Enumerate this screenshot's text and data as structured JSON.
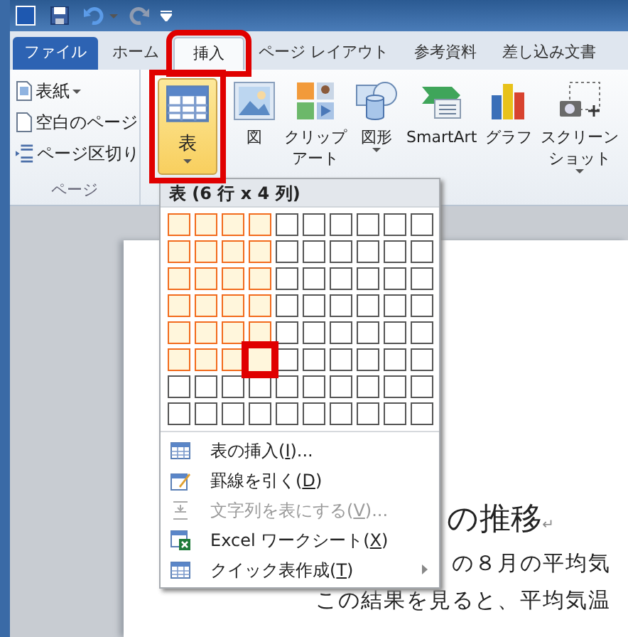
{
  "quick_access": {
    "undo_disabled": false,
    "redo_disabled": true
  },
  "tabs": [
    {
      "label": "ファイル",
      "kind": "file",
      "selected": false
    },
    {
      "label": "ホーム",
      "kind": "tab",
      "selected": false
    },
    {
      "label": "挿入",
      "kind": "tab",
      "selected": true,
      "framed": true
    },
    {
      "label": "ページ レイアウト",
      "kind": "tab",
      "selected": false
    },
    {
      "label": "参考資料",
      "kind": "tab",
      "selected": false
    },
    {
      "label": "差し込み文書",
      "kind": "tab",
      "selected": false
    }
  ],
  "page_group": {
    "items": [
      {
        "label": "表紙",
        "kind": "cover",
        "dropdown": true
      },
      {
        "label": "空白のページ",
        "kind": "blank",
        "dropdown": false
      },
      {
        "label": "ページ区切り",
        "kind": "break",
        "dropdown": false
      }
    ],
    "label": "ページ"
  },
  "table_button": {
    "label": "表",
    "open": true,
    "framed": true
  },
  "ribbon_buttons": [
    {
      "lines": [
        "図"
      ],
      "kind": "picture",
      "dropdown": false
    },
    {
      "lines": [
        "クリップ",
        "アート"
      ],
      "kind": "clipart",
      "dropdown": false
    },
    {
      "lines": [
        "図形"
      ],
      "kind": "shapes",
      "dropdown": true
    },
    {
      "lines": [
        "SmartArt"
      ],
      "kind": "smartart",
      "dropdown": false
    },
    {
      "lines": [
        "グラフ"
      ],
      "kind": "chart",
      "dropdown": false
    },
    {
      "lines": [
        "スクリーン",
        "ショット"
      ],
      "kind": "screenshot",
      "dropdown": true
    }
  ],
  "table_menu": {
    "title": "表 (6 行 x 4 列)",
    "grid": [
      {
        "cells": [
          {
            "highlighted": true,
            "pointed": false
          },
          {
            "highlighted": true,
            "pointed": false
          },
          {
            "highlighted": true,
            "pointed": false
          },
          {
            "highlighted": true,
            "pointed": false
          },
          {
            "highlighted": false,
            "pointed": false
          },
          {
            "highlighted": false,
            "pointed": false
          },
          {
            "highlighted": false,
            "pointed": false
          },
          {
            "highlighted": false,
            "pointed": false
          },
          {
            "highlighted": false,
            "pointed": false
          },
          {
            "highlighted": false,
            "pointed": false
          }
        ]
      },
      {
        "cells": [
          {
            "highlighted": true,
            "pointed": false
          },
          {
            "highlighted": true,
            "pointed": false
          },
          {
            "highlighted": true,
            "pointed": false
          },
          {
            "highlighted": true,
            "pointed": false
          },
          {
            "highlighted": false,
            "pointed": false
          },
          {
            "highlighted": false,
            "pointed": false
          },
          {
            "highlighted": false,
            "pointed": false
          },
          {
            "highlighted": false,
            "pointed": false
          },
          {
            "highlighted": false,
            "pointed": false
          },
          {
            "highlighted": false,
            "pointed": false
          }
        ]
      },
      {
        "cells": [
          {
            "highlighted": true,
            "pointed": false
          },
          {
            "highlighted": true,
            "pointed": false
          },
          {
            "highlighted": true,
            "pointed": false
          },
          {
            "highlighted": true,
            "pointed": false
          },
          {
            "highlighted": false,
            "pointed": false
          },
          {
            "highlighted": false,
            "pointed": false
          },
          {
            "highlighted": false,
            "pointed": false
          },
          {
            "highlighted": false,
            "pointed": false
          },
          {
            "highlighted": false,
            "pointed": false
          },
          {
            "highlighted": false,
            "pointed": false
          }
        ]
      },
      {
        "cells": [
          {
            "highlighted": true,
            "pointed": false
          },
          {
            "highlighted": true,
            "pointed": false
          },
          {
            "highlighted": true,
            "pointed": false
          },
          {
            "highlighted": true,
            "pointed": false
          },
          {
            "highlighted": false,
            "pointed": false
          },
          {
            "highlighted": false,
            "pointed": false
          },
          {
            "highlighted": false,
            "pointed": false
          },
          {
            "highlighted": false,
            "pointed": false
          },
          {
            "highlighted": false,
            "pointed": false
          },
          {
            "highlighted": false,
            "pointed": false
          }
        ]
      },
      {
        "cells": [
          {
            "highlighted": true,
            "pointed": false
          },
          {
            "highlighted": true,
            "pointed": false
          },
          {
            "highlighted": true,
            "pointed": false
          },
          {
            "highlighted": true,
            "pointed": false
          },
          {
            "highlighted": false,
            "pointed": false
          },
          {
            "highlighted": false,
            "pointed": false
          },
          {
            "highlighted": false,
            "pointed": false
          },
          {
            "highlighted": false,
            "pointed": false
          },
          {
            "highlighted": false,
            "pointed": false
          },
          {
            "highlighted": false,
            "pointed": false
          }
        ]
      },
      {
        "cells": [
          {
            "highlighted": true,
            "pointed": false
          },
          {
            "highlighted": true,
            "pointed": false
          },
          {
            "highlighted": true,
            "pointed": false
          },
          {
            "highlighted": true,
            "pointed": true
          },
          {
            "highlighted": false,
            "pointed": false
          },
          {
            "highlighted": false,
            "pointed": false
          },
          {
            "highlighted": false,
            "pointed": false
          },
          {
            "highlighted": false,
            "pointed": false
          },
          {
            "highlighted": false,
            "pointed": false
          },
          {
            "highlighted": false,
            "pointed": false
          }
        ]
      },
      {
        "cells": [
          {
            "highlighted": false,
            "pointed": false
          },
          {
            "highlighted": false,
            "pointed": false
          },
          {
            "highlighted": false,
            "pointed": false
          },
          {
            "highlighted": false,
            "pointed": false
          },
          {
            "highlighted": false,
            "pointed": false
          },
          {
            "highlighted": false,
            "pointed": false
          },
          {
            "highlighted": false,
            "pointed": false
          },
          {
            "highlighted": false,
            "pointed": false
          },
          {
            "highlighted": false,
            "pointed": false
          },
          {
            "highlighted": false,
            "pointed": false
          }
        ]
      },
      {
        "cells": [
          {
            "highlighted": false,
            "pointed": false
          },
          {
            "highlighted": false,
            "pointed": false
          },
          {
            "highlighted": false,
            "pointed": false
          },
          {
            "highlighted": false,
            "pointed": false
          },
          {
            "highlighted": false,
            "pointed": false
          },
          {
            "highlighted": false,
            "pointed": false
          },
          {
            "highlighted": false,
            "pointed": false
          },
          {
            "highlighted": false,
            "pointed": false
          },
          {
            "highlighted": false,
            "pointed": false
          },
          {
            "highlighted": false,
            "pointed": false
          }
        ]
      }
    ],
    "items": [
      {
        "before": "表の挿入(",
        "key": "I",
        "after": ")...",
        "kind": "insert",
        "disabled": false,
        "submenu": false
      },
      {
        "before": "罫線を引く(",
        "key": "D",
        "after": ")",
        "kind": "draw",
        "disabled": false,
        "submenu": false
      },
      {
        "before": "文字列を表にする(",
        "key": "V",
        "after": ")...",
        "kind": "convert",
        "disabled": true,
        "submenu": false
      },
      {
        "before": "Excel ワークシート(",
        "key": "X",
        "after": ")",
        "kind": "excel",
        "disabled": false,
        "submenu": false
      },
      {
        "before": "クイック表作成(",
        "key": "T",
        "after": ")",
        "kind": "quick",
        "disabled": false,
        "submenu": true
      }
    ]
  },
  "document": {
    "heading": "の推移",
    "paragraph_mark": "↵",
    "lines": [
      "の８月の平均気",
      "この結果を見ると、平均気温"
    ]
  }
}
